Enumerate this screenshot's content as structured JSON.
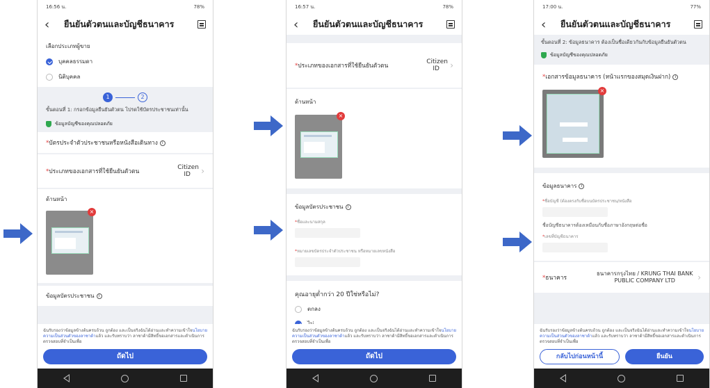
{
  "status_bar": {
    "p1_time": "16:56 น.",
    "p2_time": "16:57 น.",
    "p3_time": "17:00 น.",
    "p1_battery": "78%",
    "p2_battery": "78%",
    "p3_battery": "77%"
  },
  "header": {
    "title": "ยืนยันตัวตนและบัญชีธนาคาร"
  },
  "screen1": {
    "seller_type_label": "เลือกประเภทผู้ขาย",
    "option_individual": "บุคคลธรรมดา",
    "option_juristic": "นิติบุคคล",
    "step1": "1",
    "step2": "2",
    "step_desc": "ขั้นตอนที่ 1: กรอกข้อมูลยืนยันตัวตน โปรดใช้บัตรประชาชนเท่านั้น",
    "secure_note": "ข้อมูลบัญชีของคุณปลอดภัย",
    "id_section_title": "บัตรประจำตัวประชาชนหรือหนังสือเดินทาง",
    "doc_type_label": "ประเภทของเอกสารที่ใช้ยืนยันตัวตน",
    "doc_type_value": "Citizen ID",
    "front_label": "ด้านหน้า",
    "idinfo_title": "ข้อมูลบัตรประชาชน",
    "consent_prefix": "ฉันรับรองว่าข้อมูลข้างต้นครบถ้วน ถูกต้อง และเป็นจริงฉันได้อ่านและทำความเข้าใจ",
    "consent_link": "นโยบายความเป็นส่วนตัวของลาซาด้า",
    "consent_suffix": "แล้ว และรับทราบว่า ลาซาด้ามีสิทธิ์ขอเอกสารและดำเนินการตรวจสอบที่จำเป็นเพื่อ",
    "next_button": "ถัดไป"
  },
  "screen2": {
    "doc_type_label": "ประเภทของเอกสารที่ใช้ยืนยันตัวตน",
    "doc_type_value": "Citizen ID",
    "front_label": "ด้านหน้า",
    "idinfo_title": "ข้อมูลบัตรประชาชน",
    "name_label": "ชื่อและนามสกุล",
    "idno_label": "หมายเลขบัตรประจำตัวประชาชน หรือหมายเลขหนังสือ",
    "age_question": "คุณอายุต่ำกว่า 20 ปีใช่หรือไม่?",
    "age_yes": "ตกลง",
    "age_no": "ไม่",
    "next_button": "ถัดไป"
  },
  "screen3": {
    "step_desc": "ขั้นตอนที่ 2: ข้อมูลธนาคาร ต้องเป็นชื่อเดียวกันกับข้อมูลยืนยันตัวตน",
    "secure_note": "ข้อมูลบัญชีของคุณปลอดภัย",
    "bank_doc_title": "เอกสารข้อมูลธนาคาร (หน้าแรกของสมุดเงินฝาก)",
    "bank_info_title": "ข้อมูลธนาคาร",
    "account_name_label": "ชื่อบัญชี (ต้องตรงกับชื่อบนบัตรประชาชน/หนังสือ",
    "account_name_hint": "ชื่อบัญชีธนาคารต้องเหมือนกับชื่อภาษาอังกฤษต่อชื่อ",
    "account_no_label": "เลขที่บัญชีธนาคาร",
    "bank_label": "ธนาคาร",
    "bank_value": "ธนาคารกรุงไทย / KRUNG THAI BANK PUBLIC COMPANY LTD",
    "back_button": "กลับไปก่อนหน้านี้",
    "confirm_button": "ยืนยัน"
  },
  "colors": {
    "primary": "#3a63d8",
    "required": "#e23b3b",
    "secure": "#2fa84f",
    "arrow": "#3d68c8"
  },
  "icons": [
    "back-arrow-icon",
    "document-icon",
    "shield-icon",
    "delete-icon",
    "info-icon",
    "chevron-right-icon",
    "arrow-right-icon"
  ]
}
